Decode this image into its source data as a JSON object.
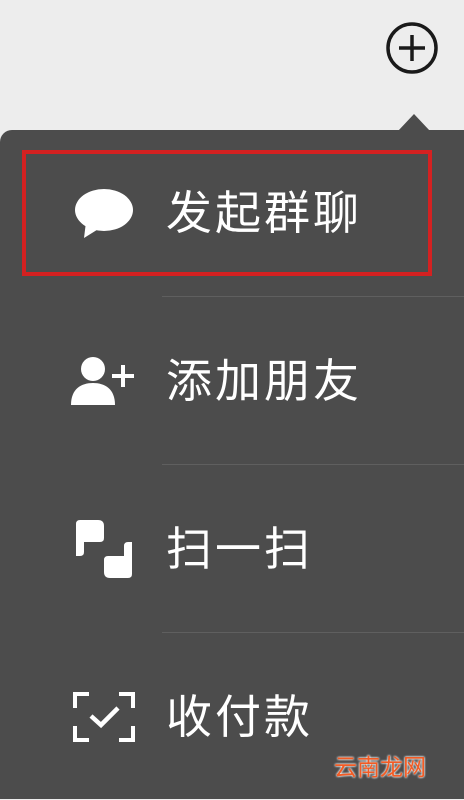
{
  "header": {
    "add_icon": "plus-circle-icon"
  },
  "menu": {
    "items": [
      {
        "label": "发起群聊",
        "icon": "chat-bubble-icon"
      },
      {
        "label": "添加朋友",
        "icon": "add-friend-icon"
      },
      {
        "label": "扫一扫",
        "icon": "scan-icon"
      },
      {
        "label": "收付款",
        "icon": "payment-icon"
      }
    ]
  },
  "colors": {
    "menu_background": "#4c4c4c",
    "top_background": "#ededed",
    "highlight_border": "#d42121",
    "watermark": "#f25b24"
  },
  "watermark": {
    "text": "云南龙网"
  }
}
